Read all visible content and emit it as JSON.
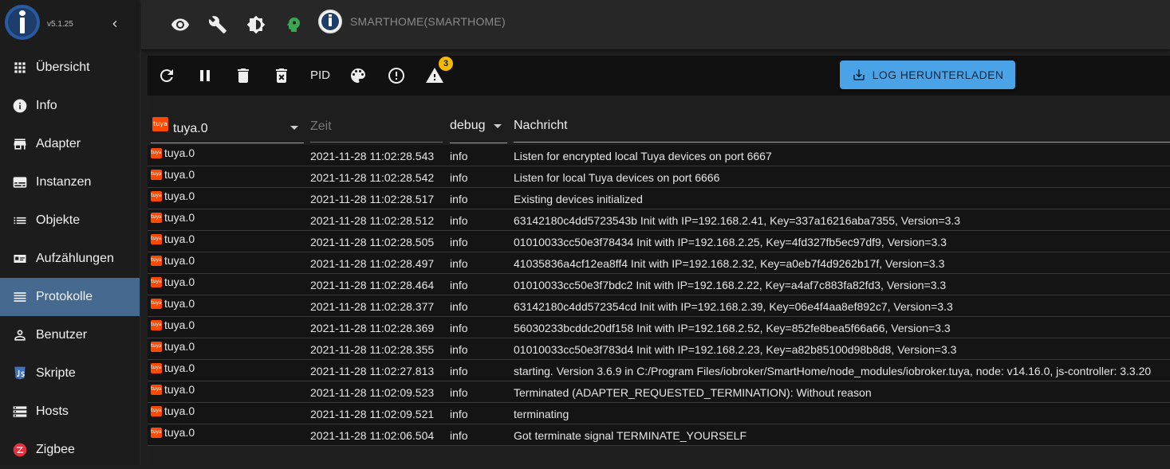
{
  "app": {
    "version": "v5.1.25"
  },
  "sidebar": {
    "items": [
      {
        "label": "Übersicht",
        "icon": "apps-icon",
        "name": "sidebar-item-uebersicht",
        "active": false
      },
      {
        "label": "Info",
        "icon": "info-icon",
        "name": "sidebar-item-info",
        "active": false
      },
      {
        "label": "Adapter",
        "icon": "store-icon",
        "name": "sidebar-item-adapter",
        "active": false
      },
      {
        "label": "Instanzen",
        "icon": "subtitles-icon",
        "name": "sidebar-item-instanzen",
        "active": false
      },
      {
        "label": "Objekte",
        "icon": "list-icon",
        "name": "sidebar-item-objekte",
        "active": false
      },
      {
        "label": "Aufzählungen",
        "icon": "featured-icon",
        "name": "sidebar-item-aufzaehlungen",
        "active": false
      },
      {
        "label": "Protokolle",
        "icon": "lines-icon",
        "name": "sidebar-item-protokolle",
        "active": true
      },
      {
        "label": "Benutzer",
        "icon": "person-icon",
        "name": "sidebar-item-benutzer",
        "active": false
      },
      {
        "label": "Skripte",
        "icon": "js-icon",
        "name": "sidebar-item-skripte",
        "active": false
      },
      {
        "label": "Hosts",
        "icon": "storage-icon",
        "name": "sidebar-item-hosts",
        "active": false
      },
      {
        "label": "Zigbee",
        "icon": "zigbee-icon",
        "name": "sidebar-item-zigbee",
        "active": false
      }
    ]
  },
  "topbar": {
    "host_name": "SMARTHOME(SMARTHOME)",
    "icons": [
      "eye-icon",
      "wrench-icon",
      "brightness-icon",
      "expert-head-icon",
      "iobroker-logo-icon"
    ]
  },
  "logbar": {
    "pid_label": "PID",
    "warning_count": "3",
    "download_label": "LOG HERUNTERLADEN"
  },
  "table": {
    "filter_adapter": "tuya.0",
    "time_placeholder": "Zeit",
    "filter_level": "debug",
    "message_header": "Nachricht",
    "rows": [
      {
        "source": "tuya.0",
        "time": "2021-11-28 11:02:28.543",
        "level": "info",
        "message": "Listen for encrypted local Tuya devices on port 6667"
      },
      {
        "source": "tuya.0",
        "time": "2021-11-28 11:02:28.542",
        "level": "info",
        "message": "Listen for local Tuya devices on port 6666"
      },
      {
        "source": "tuya.0",
        "time": "2021-11-28 11:02:28.517",
        "level": "info",
        "message": "Existing devices initialized"
      },
      {
        "source": "tuya.0",
        "time": "2021-11-28 11:02:28.512",
        "level": "info",
        "message": "63142180c4dd5723543b Init with IP=192.168.2.41, Key=337a16216aba7355, Version=3.3"
      },
      {
        "source": "tuya.0",
        "time": "2021-11-28 11:02:28.505",
        "level": "info",
        "message": "01010033cc50e3f78434 Init with IP=192.168.2.25, Key=4fd327fb5ec97df9, Version=3.3"
      },
      {
        "source": "tuya.0",
        "time": "2021-11-28 11:02:28.497",
        "level": "info",
        "message": "41035836a4cf12ea8ff4 Init with IP=192.168.2.32, Key=a0eb7f4d9262b17f, Version=3.3"
      },
      {
        "source": "tuya.0",
        "time": "2021-11-28 11:02:28.464",
        "level": "info",
        "message": "01010033cc50e3f7bdc2 Init with IP=192.168.2.22, Key=a4af7c883fa82fd3, Version=3.3"
      },
      {
        "source": "tuya.0",
        "time": "2021-11-28 11:02:28.377",
        "level": "info",
        "message": "63142180c4dd572354cd Init with IP=192.168.2.39, Key=06e4f4aa8ef892c7, Version=3.3"
      },
      {
        "source": "tuya.0",
        "time": "2021-11-28 11:02:28.369",
        "level": "info",
        "message": "56030233bcddc20df158 Init with IP=192.168.2.52, Key=852fe8bea5f66a66, Version=3.3"
      },
      {
        "source": "tuya.0",
        "time": "2021-11-28 11:02:28.355",
        "level": "info",
        "message": "01010033cc50e3f783d4 Init with IP=192.168.2.23, Key=a82b85100d98b8d8, Version=3.3"
      },
      {
        "source": "tuya.0",
        "time": "2021-11-28 11:02:27.813",
        "level": "info",
        "message": "starting. Version 3.6.9 in C:/Program Files/iobroker/SmartHome/node_modules/iobroker.tuya, node: v14.16.0, js-controller: 3.3.20"
      },
      {
        "source": "tuya.0",
        "time": "2021-11-28 11:02:09.523",
        "level": "info",
        "message": "Terminated (ADAPTER_REQUESTED_TERMINATION): Without reason"
      },
      {
        "source": "tuya.0",
        "time": "2021-11-28 11:02:09.521",
        "level": "info",
        "message": "terminating"
      },
      {
        "source": "tuya.0",
        "time": "2021-11-28 11:02:06.504",
        "level": "info",
        "message": "Got terminate signal TERMINATE_YOURSELF"
      }
    ]
  },
  "colors": {
    "accent": "#45698f",
    "download_button": "#4aa3e6",
    "badge": "#f5b800",
    "expert_icon": "#3ba650",
    "tuya_brand": "#ff4800"
  }
}
